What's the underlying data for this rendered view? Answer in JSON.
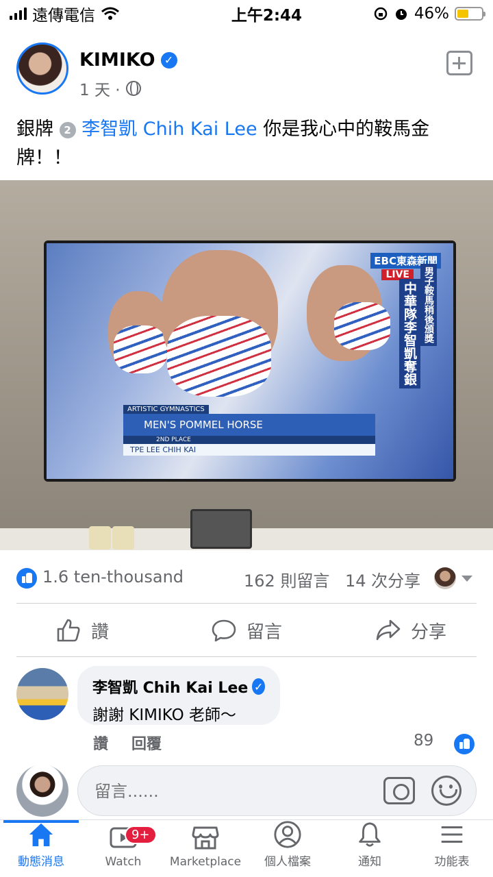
{
  "status_bar": {
    "carrier": "遠傳電信",
    "time": "上午2:44",
    "battery": "46%",
    "battery_level": 0.46
  },
  "post": {
    "author": "KIMIKO",
    "time": "1 天 ·",
    "text_prefix": "銀牌",
    "medal_number": "2",
    "mention": "李智凱 Chih Kai Lee",
    "text_suffix": "你是我心中的鞍馬金牌！！",
    "photo": {
      "channel": "EBC東森新聞",
      "live": "LIVE",
      "vertical_caption_1": "男子鞍馬稍後頒獎",
      "vertical_caption_2": "中華隊李智凱奪銀",
      "lower_third": {
        "category": "ARTISTIC GYMNASTICS",
        "event": "MEN'S POMMEL HORSE",
        "place": "2ND PLACE",
        "athlete": "TPE  LEE CHIH KAI"
      }
    }
  },
  "reactions": {
    "count": "1.6 ten-thousand",
    "comments": "162 則留言",
    "shares": "14 次分享"
  },
  "actions": {
    "like": "讚",
    "comment": "留言",
    "share": "分享"
  },
  "comment": {
    "author": "李智凱 Chih Kai Lee",
    "text": "謝謝 KIMIKO 老師～",
    "like_action": "讚",
    "reply_action": "回覆",
    "likes": "89"
  },
  "composer": {
    "placeholder": "留言......"
  },
  "bottom_nav": {
    "items": [
      {
        "label": "動態消息",
        "icon": "home-icon"
      },
      {
        "label": "Watch",
        "icon": "watch-icon",
        "badge": "9+"
      },
      {
        "label": "Marketplace",
        "icon": "marketplace-icon"
      },
      {
        "label": "個人檔案",
        "icon": "profile-icon"
      },
      {
        "label": "通知",
        "icon": "bell-icon"
      },
      {
        "label": "功能表",
        "icon": "menu-icon"
      }
    ]
  },
  "colors": {
    "accent": "#1877f2",
    "badge": "#e41e3f",
    "secondary_text": "#65676b"
  }
}
